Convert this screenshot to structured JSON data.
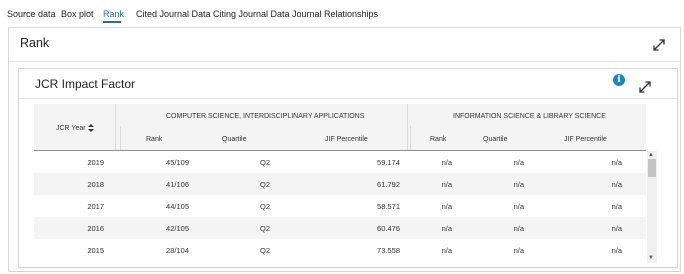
{
  "tabs": [
    {
      "label": "Source data"
    },
    {
      "label": "Box plot"
    },
    {
      "label": "Rank"
    },
    {
      "label": "Cited Journal Data"
    },
    {
      "label": "Citing Journal Data"
    },
    {
      "label": "Journal Relationships"
    }
  ],
  "active_tab": "Rank",
  "panel": {
    "title": "Rank"
  },
  "card": {
    "title": "JCR Impact Factor",
    "info": "i"
  },
  "table": {
    "year_header": "JCR Year",
    "groups": [
      {
        "title": "COMPUTER SCIENCE, INTERDISCIPLINARY APPLICATIONS"
      },
      {
        "title": "INFORMATION SCIENCE & LIBRARY SCIENCE"
      }
    ],
    "columns": [
      "Rank",
      "Quartile",
      "JIF Percentile",
      "Rank",
      "Quartile",
      "JIF Percentile"
    ],
    "rows": [
      {
        "year": "2019",
        "cs_rank": "45/109",
        "cs_quartile": "Q2",
        "cs_pct": "59.174",
        "is_rank": "n/a",
        "is_quartile": "n/a",
        "is_pct": "n/a"
      },
      {
        "year": "2018",
        "cs_rank": "41/106",
        "cs_quartile": "Q2",
        "cs_pct": "61.792",
        "is_rank": "n/a",
        "is_quartile": "n/a",
        "is_pct": "n/a"
      },
      {
        "year": "2017",
        "cs_rank": "44/105",
        "cs_quartile": "Q2",
        "cs_pct": "58.571",
        "is_rank": "n/a",
        "is_quartile": "n/a",
        "is_pct": "n/a"
      },
      {
        "year": "2016",
        "cs_rank": "42/105",
        "cs_quartile": "Q2",
        "cs_pct": "60.476",
        "is_rank": "n/a",
        "is_quartile": "n/a",
        "is_pct": "n/a"
      },
      {
        "year": "2015",
        "cs_rank": "28/104",
        "cs_quartile": "Q2",
        "cs_pct": "73.558",
        "is_rank": "n/a",
        "is_quartile": "n/a",
        "is_pct": "n/a"
      }
    ]
  },
  "colors": {
    "accent": "#2b6ca3",
    "info": "#1a87c0",
    "header_bg": "#f4f4f4"
  },
  "icons": {
    "expand": "expand-arrows-icon",
    "info": "info-icon",
    "sort": "sort-icon"
  }
}
